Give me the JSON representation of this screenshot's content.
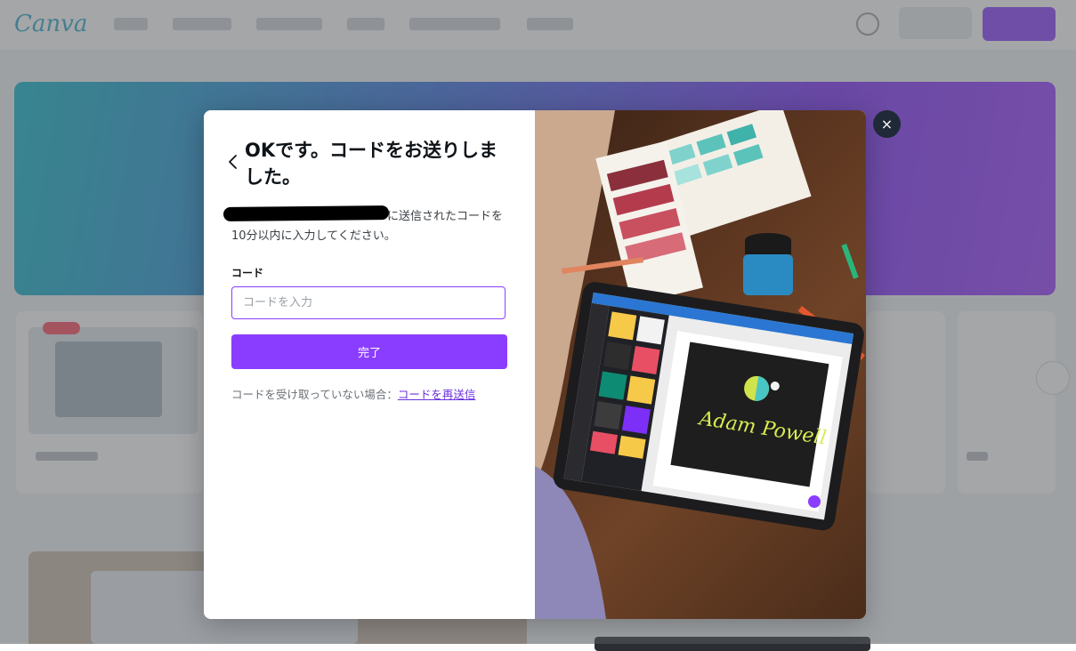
{
  "modal": {
    "title": "OKです。コードをお送りしました。",
    "description_suffix": "に送信されたコードを",
    "description_line2": "10分以内に入力してください。",
    "code_label": "コード",
    "code_input": {
      "value": "",
      "placeholder": "コードを入力"
    },
    "submit_label": "完了",
    "resend_prefix": "コードを受け取っていない場合：",
    "resend_link": "コードを再送信",
    "close_label": "×"
  },
  "photo": {
    "signature_text": "Adam Powell"
  },
  "colors": {
    "accent": "#8b3dff",
    "link": "#6b2fe0",
    "close_button": "#1f2937"
  }
}
